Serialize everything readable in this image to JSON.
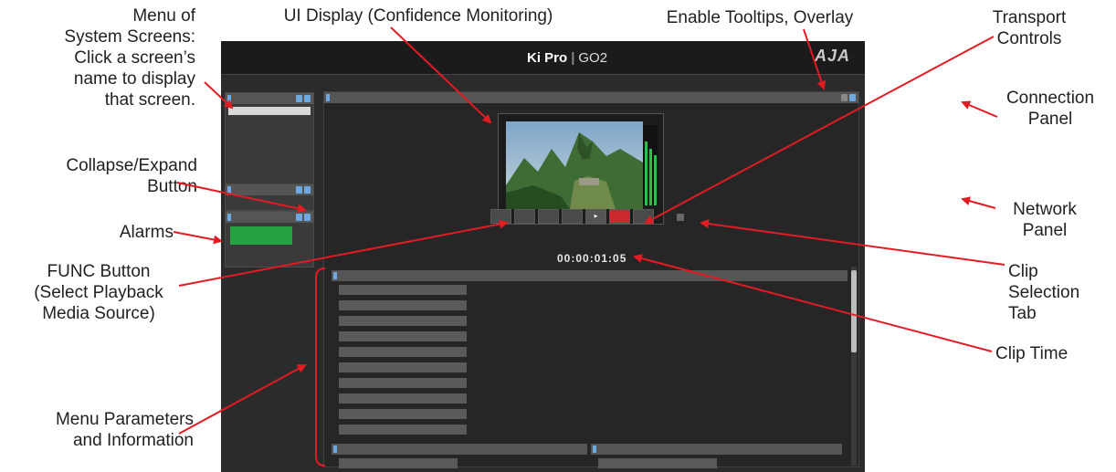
{
  "callouts": {
    "menu_screens": "Menu of\nSystem Screens:\nClick a screen’s\nname to display\nthat screen.",
    "ui_display": "UI Display (Confidence Monitoring)",
    "tooltips": "Enable Tooltips, Overlay",
    "transport": "Transport\nControls",
    "collapse": "Collapse/Expand\nButton",
    "connection": "Connection\nPanel",
    "alarms": "Alarms",
    "network": "Network\nPanel",
    "func": "FUNC Button\n(Select Playback\nMedia Source)",
    "clip_tab": "Clip\nSelection\nTab",
    "clip_time": "Clip Time",
    "menu_params": "Menu Parameters\nand  Information"
  },
  "screen": {
    "brand": "Ki Pro",
    "separator": "|",
    "model": "GO2",
    "logo": "AJA",
    "clip_time": "00:00:01:05"
  },
  "colors": {
    "accent": "#6ea8e0",
    "alarm_green": "#25a244",
    "record_red": "#c9282d",
    "arrow_red": "#e31b23"
  },
  "icons": {
    "tooltips": "tooltip-icon",
    "overlay": "overlay-icon",
    "collapse": "collapse-icon"
  }
}
